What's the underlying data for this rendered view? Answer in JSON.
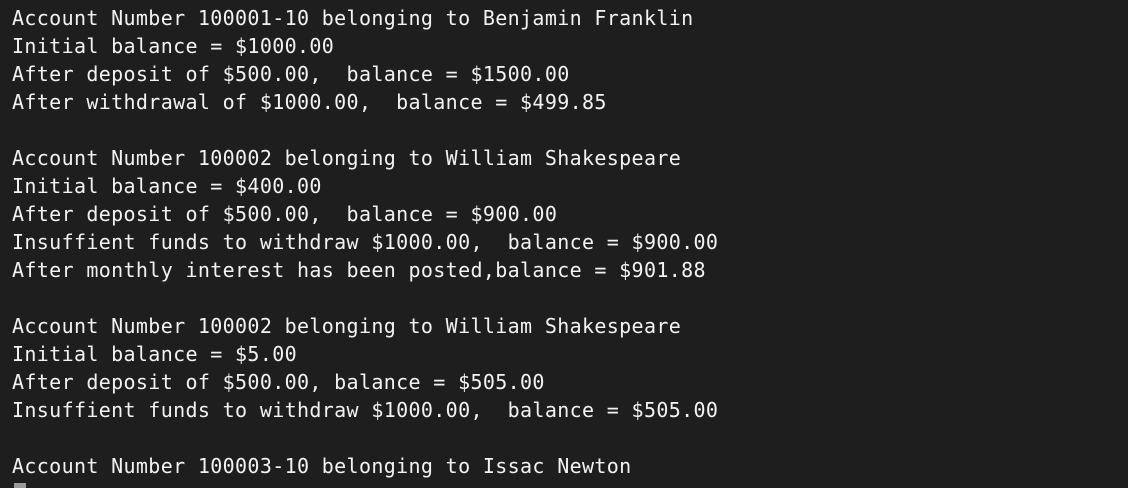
{
  "terminal": {
    "lines": [
      "",
      "Account Number 100001-10 belonging to Benjamin Franklin",
      "Initial balance = $1000.00",
      "After deposit of $500.00,  balance = $1500.00",
      "After withdrawal of $1000.00,  balance = $499.85",
      "",
      "Account Number 100002 belonging to William Shakespeare",
      "Initial balance = $400.00",
      "After deposit of $500.00,  balance = $900.00",
      "Insuffient funds to withdraw $1000.00,  balance = $900.00",
      "After monthly interest has been posted,balance = $901.88",
      "",
      "Account Number 100002 belonging to William Shakespeare",
      "Initial balance = $5.00",
      "After deposit of $500.00, balance = $505.00",
      "Insuffient funds to withdraw $1000.00,  balance = $505.00",
      "",
      "Account Number 100003-10 belonging to Issac Newton",
      ""
    ]
  }
}
